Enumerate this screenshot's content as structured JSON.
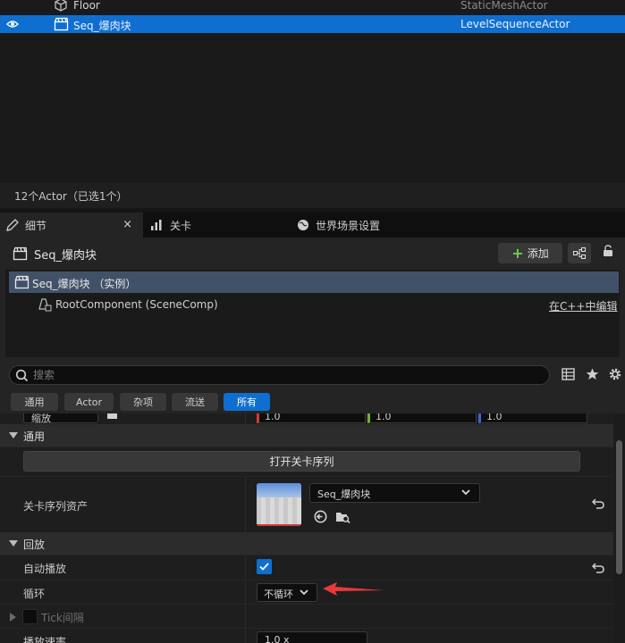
{
  "outliner": {
    "rows": [
      {
        "name": "Floor",
        "type": "StaticMeshActor"
      },
      {
        "name": "Seq_爆肉块",
        "type": "LevelSequenceActor"
      }
    ],
    "footer": "12个Actor（已选1个）"
  },
  "tabs": {
    "details": "细节",
    "close": "×",
    "level": "关卡",
    "world_settings": "世界场景设置"
  },
  "details": {
    "actor_name": "Seq_爆肉块",
    "add_label": "添加",
    "components": {
      "selected": "Seq_爆肉块 （实例）",
      "root": "RootComponent (SceneComp)",
      "edit_cpp": "在C++中编辑"
    },
    "search": {
      "placeholder": "搜索"
    },
    "filters": [
      "通用",
      "Actor",
      "杂项",
      "流送",
      "所有"
    ],
    "active_filter": "所有"
  },
  "properties": {
    "cat_general": "通用",
    "open_sequence": "打开关卡序列",
    "sequence_asset_label": "关卡序列资产",
    "sequence_asset_value": "Seq_爆肉块",
    "cat_playback": "回放",
    "autoplay_label": "自动播放",
    "autoplay_checked": true,
    "loop_label": "循环",
    "loop_value": "不循环",
    "tick_interval_label": "Tick间隔",
    "play_rate_label": "播放速率",
    "play_rate_value": "1.0 x",
    "prev_scale_label": "缩放",
    "prev_xyz": [
      "1.0",
      "1.0",
      "1.0"
    ]
  },
  "colors": {
    "selection_blue": "#0f6fd0",
    "component_selected": "#415268",
    "add_plus_green": "#6fcf4f",
    "annotation_arrow": "#e83a3a"
  }
}
